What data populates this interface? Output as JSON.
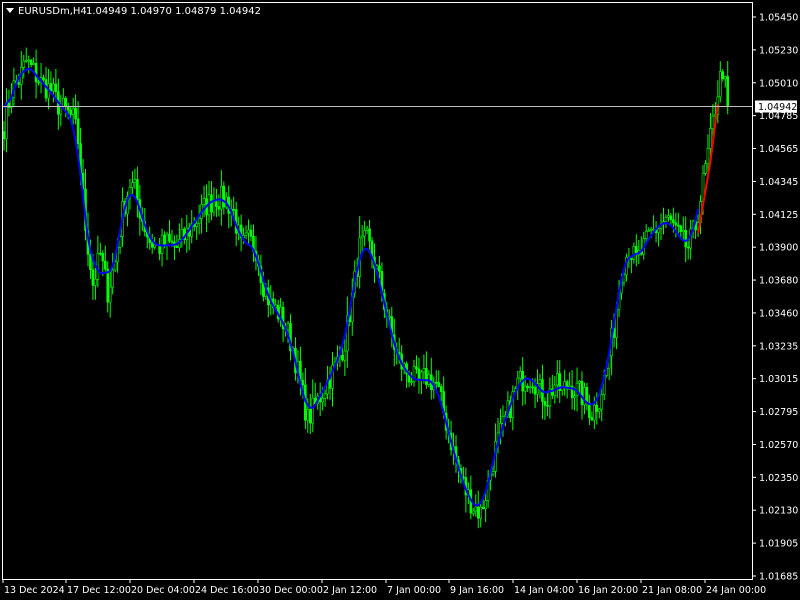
{
  "header": {
    "symbol": "EURUSDm,H4",
    "ohlc": "1.04949 1.04970 1.04879 1.04942",
    "menu_icon": "triangle-down-icon"
  },
  "colors": {
    "background": "#000000",
    "frame": "#ffffff",
    "candle": "#00ff00",
    "ma_line": "#0000ff",
    "forecast_line": "#ff0000",
    "bid_line": "#c0c0c0",
    "text": "#ffffff"
  },
  "current_price": "1.04942",
  "chart_data": {
    "type": "candlestick",
    "title": "EURUSDm,H4",
    "ylim": [
      1.0166,
      1.0556
    ],
    "y_ticks": [
      "1.05450",
      "1.05230",
      "1.05010",
      "1.04785",
      "1.04565",
      "1.04345",
      "1.04125",
      "1.03900",
      "1.03680",
      "1.03460",
      "1.03235",
      "1.03015",
      "1.02795",
      "1.02570",
      "1.02350",
      "1.02130",
      "1.01905",
      "1.01685"
    ],
    "x_ticks": [
      "13 Dec 2024",
      "17 Dec 12:00",
      "20 Dec 04:00",
      "24 Dec 16:00",
      "30 Dec 00:00",
      "2 Jan 12:00",
      "7 Jan 00:00",
      "9 Jan 16:00",
      "14 Jan 04:00",
      "16 Jan 20:00",
      "21 Jan 08:00",
      "24 Jan 00:00"
    ],
    "bid": 1.04942,
    "grid": false,
    "anchors": [
      [
        0,
        1.048
      ],
      [
        3,
        1.0505
      ],
      [
        6,
        1.0512
      ],
      [
        9,
        1.0525
      ],
      [
        12,
        1.0518
      ],
      [
        15,
        1.051
      ],
      [
        19,
        1.0505
      ],
      [
        22,
        1.0495
      ],
      [
        25,
        1.049
      ],
      [
        28,
        1.0485
      ],
      [
        30,
        1.047
      ],
      [
        33,
        1.041
      ],
      [
        36,
        1.037
      ],
      [
        39,
        1.039
      ],
      [
        42,
        1.0365
      ],
      [
        45,
        1.0385
      ],
      [
        48,
        1.042
      ],
      [
        51,
        1.044
      ],
      [
        53,
        1.0435
      ],
      [
        56,
        1.0415
      ],
      [
        59,
        1.04
      ],
      [
        62,
        1.0395
      ],
      [
        66,
        1.0398
      ],
      [
        70,
        1.0395
      ],
      [
        74,
        1.0405
      ],
      [
        78,
        1.0415
      ],
      [
        82,
        1.0425
      ],
      [
        86,
        1.043
      ],
      [
        90,
        1.0428
      ],
      [
        93,
        1.042
      ],
      [
        96,
        1.0395
      ],
      [
        99,
        1.04
      ],
      [
        102,
        1.0395
      ],
      [
        105,
        1.037
      ],
      [
        108,
        1.0355
      ],
      [
        111,
        1.035
      ],
      [
        114,
        1.034
      ],
      [
        117,
        1.0325
      ],
      [
        120,
        1.03
      ],
      [
        123,
        1.0275
      ],
      [
        126,
        1.0285
      ],
      [
        129,
        1.0295
      ],
      [
        132,
        1.0305
      ],
      [
        135,
        1.0315
      ],
      [
        138,
        1.033
      ],
      [
        141,
        1.036
      ],
      [
        144,
        1.0395
      ],
      [
        147,
        1.04
      ],
      [
        150,
        1.0385
      ],
      [
        153,
        1.0365
      ],
      [
        156,
        1.034
      ],
      [
        159,
        1.032
      ],
      [
        162,
        1.031
      ],
      [
        165,
        1.0305
      ],
      [
        168,
        1.03
      ],
      [
        171,
        1.0305
      ],
      [
        175,
        1.03
      ],
      [
        178,
        1.028
      ],
      [
        181,
        1.026
      ],
      [
        184,
        1.024
      ],
      [
        187,
        1.0225
      ],
      [
        190,
        1.0215
      ],
      [
        193,
        1.021
      ],
      [
        196,
        1.023
      ],
      [
        199,
        1.0255
      ],
      [
        202,
        1.027
      ],
      [
        205,
        1.0285
      ],
      [
        208,
        1.03
      ],
      [
        211,
        1.0305
      ],
      [
        214,
        1.0305
      ],
      [
        217,
        1.0295
      ],
      [
        220,
        1.029
      ],
      [
        223,
        1.03
      ],
      [
        226,
        1.0295
      ],
      [
        229,
        1.03
      ],
      [
        232,
        1.0295
      ],
      [
        235,
        1.029
      ],
      [
        238,
        1.028
      ],
      [
        241,
        1.029
      ],
      [
        244,
        1.031
      ],
      [
        247,
        1.034
      ],
      [
        250,
        1.038
      ],
      [
        253,
        1.0395
      ],
      [
        256,
        1.0385
      ],
      [
        259,
        1.0395
      ],
      [
        262,
        1.0405
      ],
      [
        265,
        1.041
      ],
      [
        268,
        1.0415
      ],
      [
        271,
        1.041
      ],
      [
        274,
        1.04
      ],
      [
        277,
        1.0395
      ],
      [
        280,
        1.041
      ],
      [
        283,
        1.044
      ],
      [
        286,
        1.047
      ],
      [
        289,
        1.0505
      ],
      [
        291,
        1.052
      ],
      [
        293,
        1.0494
      ]
    ],
    "forecast": [
      [
        281,
        1.0405
      ],
      [
        286,
        1.0455
      ],
      [
        289,
        1.0495
      ]
    ],
    "visible_bars": 294
  }
}
